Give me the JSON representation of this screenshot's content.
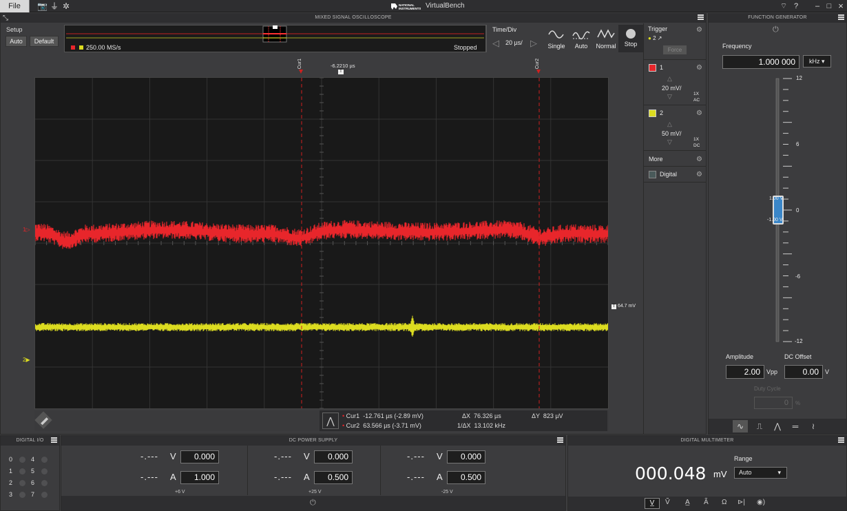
{
  "app": {
    "title": "VirtualBench",
    "brand": "NATIONAL INSTRUMENTS",
    "file_menu": "File"
  },
  "window": {
    "help": "?",
    "minimize": "–",
    "maximize": "□",
    "close": "×"
  },
  "oscilloscope": {
    "header": "MIXED SIGNAL OSCILLOSCOPE",
    "setup": {
      "label": "Setup",
      "auto": "Auto",
      "default": "Default"
    },
    "overview": {
      "sample_rate": "250.00 MS/s",
      "status": "Stopped"
    },
    "timebase": {
      "label": "Time/Div",
      "value": "20 µs/"
    },
    "modes": [
      {
        "label": "Single"
      },
      {
        "label": "Auto"
      },
      {
        "label": "Normal"
      },
      {
        "label": "Stop"
      }
    ],
    "trigger": {
      "label": "Trigger",
      "channel": "2",
      "force": "Force",
      "time_label": "-6.2210 µs",
      "level_label": "64.7 mV"
    },
    "channels": [
      {
        "id": "1",
        "scale": "20 mV/",
        "probe": "1X",
        "coupling": "AC",
        "color": "#e8262b"
      },
      {
        "id": "2",
        "scale": "50 mV/",
        "probe": "1X",
        "coupling": "DC",
        "color": "#dcdc20"
      }
    ],
    "more": "More",
    "digital": "Digital",
    "cursor_labels": {
      "cur1": "Cur1",
      "cur2": "Cur2"
    },
    "cursors": {
      "cur1": {
        "name": "Cur1",
        "value": "-12.761 µs (-2.89 mV)"
      },
      "cur2": {
        "name": "Cur2",
        "value": "63.566 µs (-3.71 mV)"
      },
      "dx": "ΔX  76.326 µs",
      "inv_dx": "1/ΔX  13.102 kHz",
      "dy": "ΔY  823 µV"
    }
  },
  "function_generator": {
    "header": "FUNCTION GENERATOR",
    "frequency": {
      "label": "Frequency",
      "value": "1.000 000",
      "unit": "kHz"
    },
    "scale": {
      "top": "12",
      "t6": "6",
      "zero": "0",
      "b6": "-6",
      "bottom": "-12"
    },
    "marker_high": "1.00 V",
    "marker_low": "-1.00 V",
    "amplitude": {
      "label": "Amplitude",
      "value": "2.00",
      "unit": "Vpp"
    },
    "offset": {
      "label": "DC Offset",
      "value": "0.00",
      "unit": "V"
    },
    "duty": {
      "label": "Duty Cycle",
      "value": "0",
      "unit": "%"
    }
  },
  "digital_io": {
    "header": "DIGITAL I/O",
    "left": [
      "0",
      "1",
      "2",
      "3"
    ],
    "right": [
      "4",
      "5",
      "6",
      "7"
    ]
  },
  "power_supply": {
    "header": "DC POWER SUPPLY",
    "channels": [
      {
        "v_read": "-.---",
        "v_set": "0.000",
        "a_read": "-.---",
        "a_set": "1.000",
        "label": "+6 V"
      },
      {
        "v_read": "-.---",
        "v_set": "0.000",
        "a_read": "-.---",
        "a_set": "0.500",
        "label": "+25 V"
      },
      {
        "v_read": "-.---",
        "v_set": "0.000",
        "a_read": "-.---",
        "a_set": "0.500",
        "label": "-25 V"
      }
    ],
    "v_unit": "V",
    "a_unit": "A"
  },
  "dmm": {
    "header": "DIGITAL MULTIMETER",
    "reading": "000.048",
    "unit": "mV",
    "range_label": "Range",
    "range_value": "Auto"
  }
}
